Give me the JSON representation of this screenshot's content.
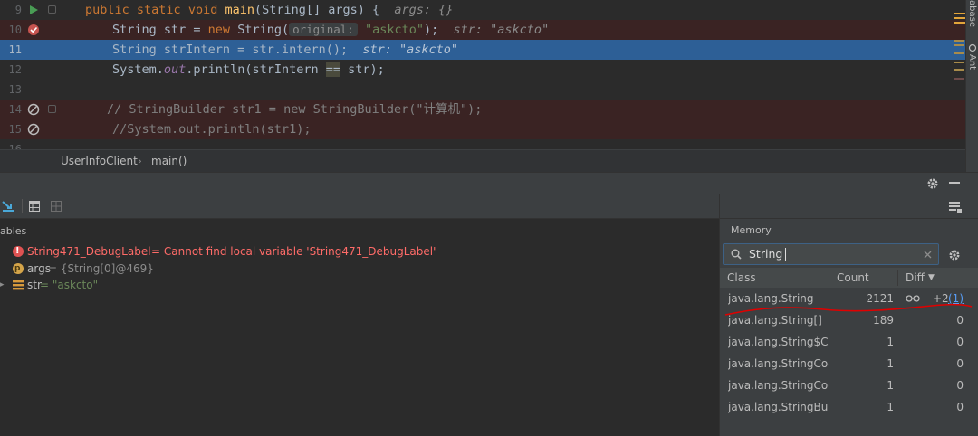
{
  "editor": {
    "lines": [
      {
        "num": "9"
      },
      {
        "num": "10"
      },
      {
        "num": "11"
      },
      {
        "num": "12"
      },
      {
        "num": "13"
      },
      {
        "num": "14"
      },
      {
        "num": "15"
      },
      {
        "num": "16"
      }
    ],
    "code": {
      "l9": {
        "kw1": "public ",
        "kw2": "static ",
        "kw3": "void ",
        "fn": "main",
        "rest": "(String[] args) {",
        "hint": "args: {}"
      },
      "l10": {
        "a": "String str = ",
        "kw": "new ",
        "b": "String(",
        "inlay": "original:",
        "str": "\"askcto\"",
        "c": ");",
        "hint": "str: \"askcto\""
      },
      "l11": {
        "a": "String strIntern = str.intern();",
        "hint": "str: \"askcto\""
      },
      "l12": {
        "a": "System.",
        "field": "out",
        "b": ".println(strIntern ",
        "op": "==",
        "c": " str);"
      },
      "l14": {
        "comment": "// StringBuilder str1 = new StringBuilder(\"计算机\");"
      },
      "l15": {
        "comment": "//System.out.println(str1);"
      }
    },
    "breadcrumb": {
      "file": "UserInfoClient",
      "method": "main()"
    }
  },
  "sidebar_right": {
    "label1": "abase",
    "label2": "Ant"
  },
  "variables": {
    "title": "ables",
    "items": [
      {
        "name": "String471_DebugLabel",
        "value": " = Cannot find local variable 'String471_DebugLabel'"
      },
      {
        "name": "args",
        "value": " = {String[0]@469}"
      },
      {
        "name": "str",
        "value": " = \"askcto\""
      }
    ]
  },
  "memory": {
    "title": "Memory",
    "search_value": "String",
    "columns": {
      "class": "Class",
      "count": "Count",
      "diff": "Diff"
    },
    "rows": [
      {
        "class": "java.lang.String",
        "count": "2121",
        "diff": "+2",
        "diff_extra": "(1)"
      },
      {
        "class": "java.lang.String[]",
        "count": "189",
        "diff": "0"
      },
      {
        "class": "java.lang.String$CaseInsensitiveComparator",
        "count": "1",
        "diff": "0"
      },
      {
        "class": "java.lang.StringCoding",
        "count": "1",
        "diff": "0"
      },
      {
        "class": "java.lang.StringCoding$StringDecoder",
        "count": "1",
        "diff": "0"
      },
      {
        "class": "java.lang.StringBuilder",
        "count": "1",
        "diff": "0"
      }
    ]
  },
  "colors": {
    "breakpoint_bg": "#3a2323",
    "current_line": "#2d5f96",
    "error": "#ff6b68",
    "annotation": "#e00000"
  }
}
